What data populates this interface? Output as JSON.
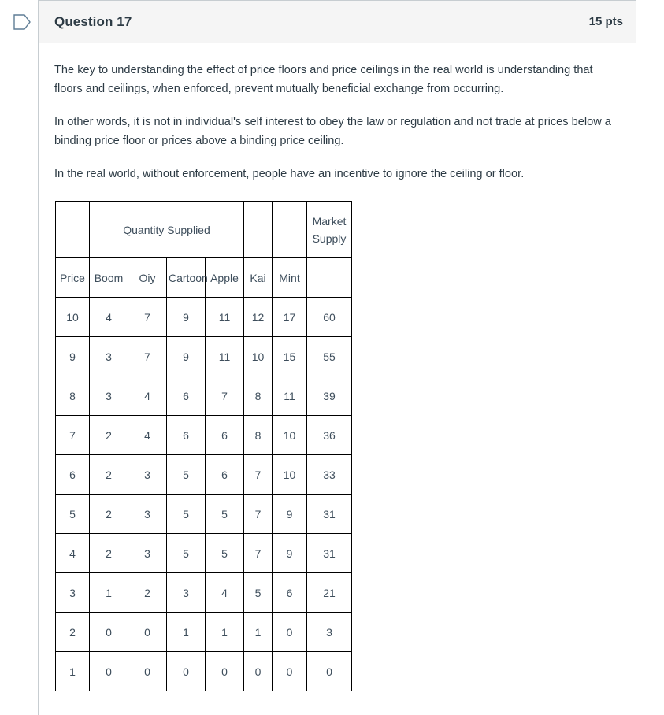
{
  "header": {
    "title": "Question 17",
    "points": "15 pts",
    "flag_icon": "flag-outline-icon"
  },
  "body": {
    "paragraphs": [
      "The key to understanding the effect of price floors and price ceilings in the real world is understanding that floors and ceilings, when enforced, prevent mutually beneficial exchange from occurring.",
      "In other words, it is not in individual's self interest to obey the law or regulation and not trade at prices below a binding price floor or prices above a binding price ceiling.",
      "In the real world, without enforcement, people have an incentive to ignore the ceiling or floor."
    ]
  },
  "table": {
    "group_header": {
      "quantity_supplied": "Quantity Supplied",
      "market_supply": "Market Supply"
    },
    "columns": [
      "Price",
      "Boom",
      "Oiy",
      "Cartoon",
      "Apple",
      "Kai",
      "Mint",
      ""
    ],
    "rows": [
      [
        "10",
        "4",
        "7",
        "9",
        "11",
        "12",
        "17",
        "60"
      ],
      [
        "9",
        "3",
        "7",
        "9",
        "11",
        "10",
        "15",
        "55"
      ],
      [
        "8",
        "3",
        "4",
        "6",
        "7",
        "8",
        "11",
        "39"
      ],
      [
        "7",
        "2",
        "4",
        "6",
        "6",
        "8",
        "10",
        "36"
      ],
      [
        "6",
        "2",
        "3",
        "5",
        "6",
        "7",
        "10",
        "33"
      ],
      [
        "5",
        "2",
        "3",
        "5",
        "5",
        "7",
        "9",
        "31"
      ],
      [
        "4",
        "2",
        "3",
        "5",
        "5",
        "7",
        "9",
        "31"
      ],
      [
        "3",
        "1",
        "2",
        "3",
        "4",
        "5",
        "6",
        "21"
      ],
      [
        "2",
        "0",
        "0",
        "1",
        "1",
        "1",
        "0",
        "3"
      ],
      [
        "1",
        "0",
        "0",
        "0",
        "0",
        "0",
        "0",
        "0"
      ]
    ]
  },
  "colors": {
    "header_background": "#f5f5f5",
    "border": "#c7cdd1",
    "text": "#2d3b45",
    "table_border": "#000000",
    "flag_icon": "#5f7d95"
  }
}
